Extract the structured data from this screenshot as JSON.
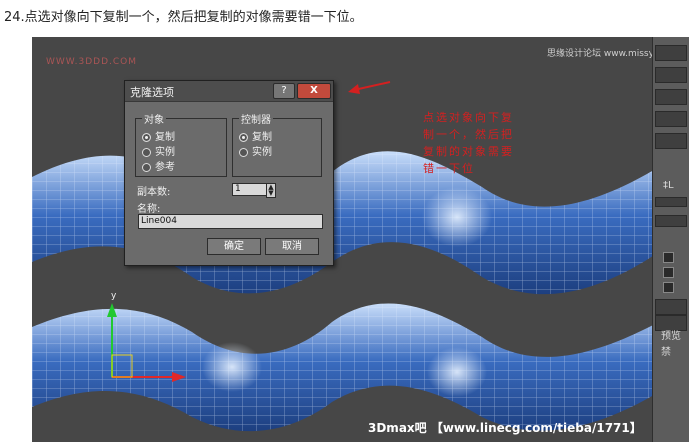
{
  "caption": "24.点选对像向下复制一个，然后把复制的对像需要错一下位。",
  "viewport": {
    "watermark_left": "WWW.3DDD.COM",
    "watermark_right": "思缘设计论坛 www.missyuan.com",
    "annotation": "点选对象向下复制一个，然后把复制的对象需要错一下位",
    "axis_y_label": "y",
    "bottom_watermark": "3Dmax吧 【www.linecg.com/tieba/1771】"
  },
  "dialog": {
    "title": "克隆选项",
    "help_button": "?",
    "close_button": "X",
    "object_group": {
      "label": "对象",
      "options": [
        "复制",
        "实例",
        "参考"
      ],
      "selected": "复制"
    },
    "controller_group": {
      "label": "控制器",
      "options": [
        "复制",
        "实例"
      ],
      "selected": "复制"
    },
    "copies_label": "副本数:",
    "copies_value": "1",
    "name_label": "名称:",
    "name_value": "Line004",
    "ok_button": "确定",
    "cancel_button": "取消"
  },
  "right_panel": {
    "icon_label": "‡L",
    "label_1": "预览",
    "label_2": "禁"
  },
  "colors": {
    "viewport_bg": "#474747",
    "shape_fill": "#2f5fb0",
    "shape_light": "#a8c8f0",
    "annotation_red": "#d42020"
  }
}
